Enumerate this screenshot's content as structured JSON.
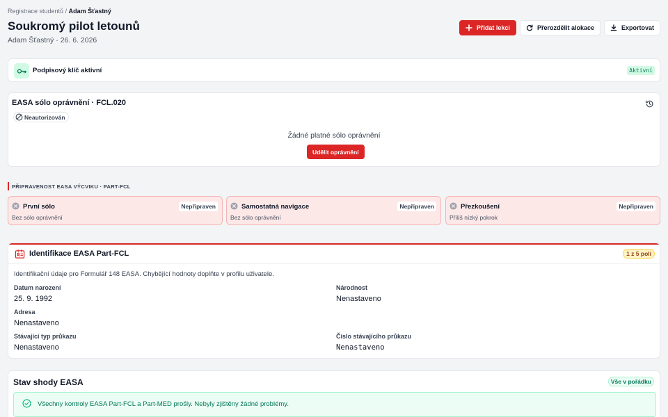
{
  "breadcrumb": {
    "root": "Registrace studentů",
    "separator": "/",
    "current": "Adam Šťastný"
  },
  "header": {
    "title": "Soukromý pilot letounů",
    "subtitle": "Adam Šťastný · 26. 6. 2026",
    "add_lesson": "Přidat lekci",
    "reallocate": "Přerozdělit alokace",
    "export": "Exportovat"
  },
  "signing_key": {
    "label": "Podpisový klíč aktivní",
    "status": "Aktivní"
  },
  "solo": {
    "title": "EASA sólo oprávnění · FCL.020",
    "status": "Neautorizován",
    "empty_text": "Žádné platné sólo oprávnění",
    "grant_button": "Udělit oprávnění"
  },
  "readiness": {
    "section_label": "PŘIPRAVENOST EASA VÝCVIKU · PART-FCL",
    "items": [
      {
        "title": "První sólo",
        "badge": "Nepřipraven",
        "sub": "Bez sólo oprávnění"
      },
      {
        "title": "Samostatná navigace",
        "badge": "Nepřipraven",
        "sub": "Bez sólo oprávnění"
      },
      {
        "title": "Přezkoušení",
        "badge": "Nepřipraven",
        "sub": "Příliš nízký pokrok"
      }
    ]
  },
  "identification": {
    "title": "Identifikace EASA Part-FCL",
    "count_badge": "1 z 5 polí",
    "description": "Identifikační údaje pro Formulář 148 EASA. Chybějící hodnoty doplňte v profilu uživatele.",
    "fields": {
      "dob_label": "Datum narození",
      "dob_value": "25. 9. 1992",
      "nationality_label": "Národnost",
      "nationality_value": "Nenastaveno",
      "address_label": "Adresa",
      "address_value": "Nenastaveno",
      "license_type_label": "Stávající typ průkazu",
      "license_type_value": "Nenastaveno",
      "license_number_label": "Číslo stávajícího průkazu",
      "license_number_value": "Nenastaveno"
    }
  },
  "compliance": {
    "title": "Stav shody EASA",
    "badge": "Vše v pořádku",
    "message": "Všechny kontroly EASA Part-FCL a Part-MED prošly. Nebyly zjištěny žádné problémy."
  },
  "colors": {
    "accent": "#dc2626",
    "success": "#047857",
    "warning": "#92400e"
  },
  "icons": {
    "add": "plus-icon",
    "reallocate": "refresh-icon",
    "export": "download-icon",
    "key": "key-icon",
    "history": "history-icon",
    "unauthorized": "ban-icon",
    "not_ready": "x-circle-icon",
    "id_card": "id-card-icon",
    "ok": "check-circle-icon"
  }
}
